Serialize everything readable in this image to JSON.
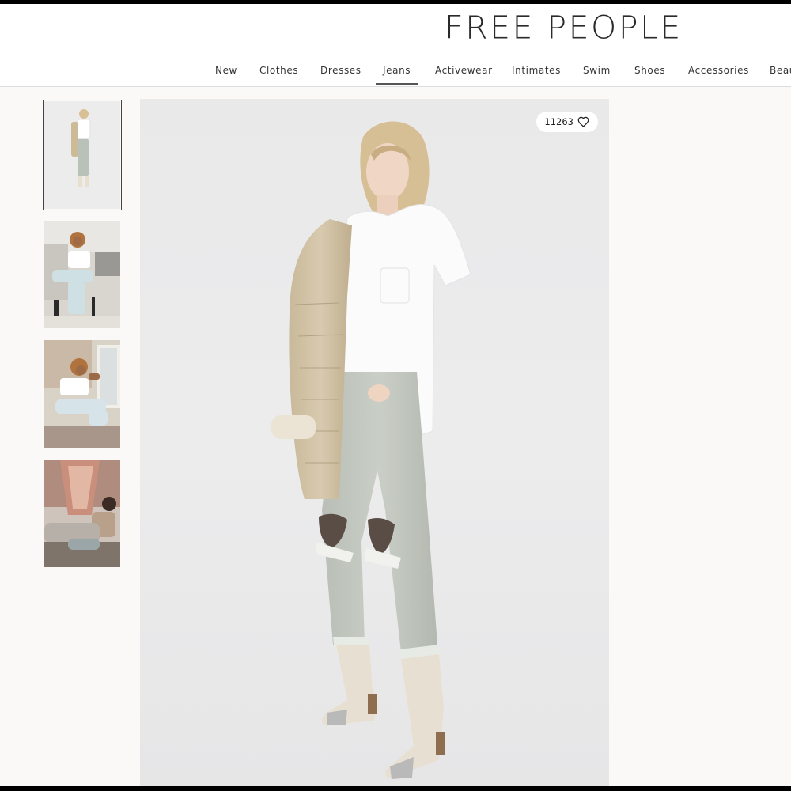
{
  "brand": {
    "logo_text": "FREE PEOPLE"
  },
  "nav": {
    "items": [
      {
        "label": "New"
      },
      {
        "label": "Clothes"
      },
      {
        "label": "Dresses"
      },
      {
        "label": "Jeans",
        "active": true
      },
      {
        "label": "Activewear"
      },
      {
        "label": "Intimates"
      },
      {
        "label": "Swim"
      },
      {
        "label": "Shoes"
      },
      {
        "label": "Accessories"
      },
      {
        "label": "Beau"
      }
    ]
  },
  "gallery": {
    "thumbnails": [
      {
        "name": "thumb-standing-model",
        "selected": true
      },
      {
        "name": "thumb-seated-model-white-top"
      },
      {
        "name": "thumb-model-on-floor"
      },
      {
        "name": "thumb-model-lounging-tapestry"
      }
    ],
    "main_image": {
      "subject": "model in white tee, distressed light-wash jeans, tan striped jacket, cream western boots"
    }
  },
  "favorite": {
    "count": "11263",
    "icon": "heart-icon"
  },
  "colors": {
    "page_bg": "#faf9f7",
    "header_bg": "#ffffff",
    "text": "#333333",
    "photo_bg": "#eaeaeb"
  }
}
